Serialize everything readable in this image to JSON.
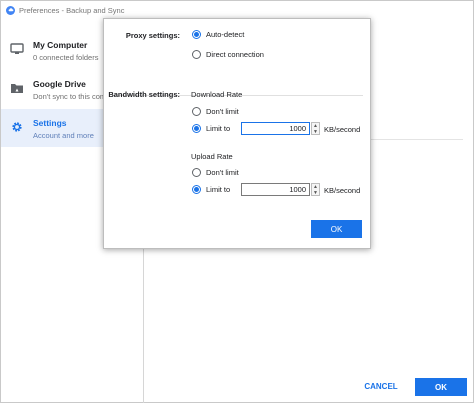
{
  "window": {
    "title": "Preferences - Backup and Sync"
  },
  "sidebar": {
    "items": [
      {
        "name": "My Computer",
        "sub": "0 connected folders",
        "icon": "monitor-icon"
      },
      {
        "name": "Google Drive",
        "sub": "Don't sync to this com",
        "icon": "drive-folder-icon"
      },
      {
        "name": "Settings",
        "sub": "Account and more",
        "icon": "gear-icon",
        "active": true
      }
    ]
  },
  "footer": {
    "cancel_label": "CANCEL",
    "ok_label": "OK"
  },
  "modal": {
    "proxy": {
      "label": "Proxy settings:",
      "options": [
        "Auto-detect",
        "Direct connection"
      ],
      "selected": "Auto-detect"
    },
    "bandwidth": {
      "label": "Bandwidth settings:",
      "download": {
        "heading": "Download Rate",
        "options": [
          "Don't limit",
          "Limit to"
        ],
        "selected": "Limit to",
        "value": "1000",
        "unit": "KB/second"
      },
      "upload": {
        "heading": "Upload Rate",
        "options": [
          "Don't limit",
          "Limit to"
        ],
        "selected": "Limit to",
        "value": "1000",
        "unit": "KB/second"
      }
    },
    "ok_label": "OK"
  },
  "colors": {
    "accent": "#1a73e8",
    "active_bg": "#e8effb"
  }
}
